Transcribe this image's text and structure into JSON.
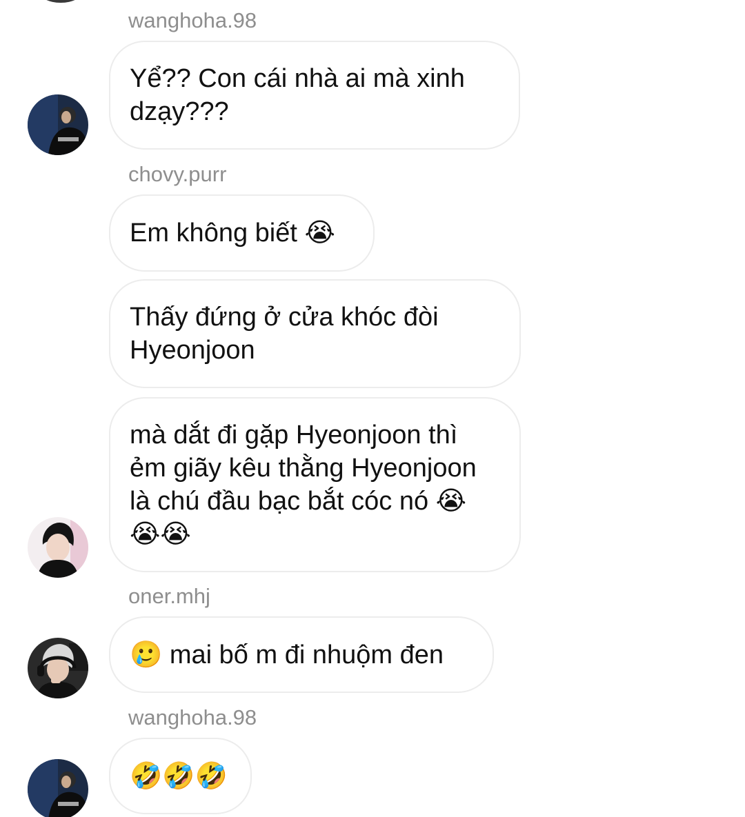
{
  "messages": [
    {
      "username": "wanghoha.98",
      "bubbles": [
        {
          "text": "Yể?? Con cái nhà ai mà xinh\ndzạy???"
        }
      ],
      "avatar_icon": "dark-profile-avatar-icon"
    },
    {
      "username": "chovy.purr",
      "bubbles": [
        {
          "text": "Em không biết 😭"
        },
        {
          "text": "Thấy đứng ở cửa khóc đòi\nHyeonjoon"
        },
        {
          "text": "mà dắt đi gặp Hyeonjoon thì\nẻm giãy kêu thằng Hyeonjoon\nlà chú đầu bạc bắt cóc nó 😭\n😭😭"
        }
      ],
      "avatar_icon": "light-profile-avatar-icon"
    },
    {
      "username": "oner.mhj",
      "bubbles": [
        {
          "text": "🥲 mai bố m đi nhuộm đen"
        }
      ],
      "avatar_icon": "headset-profile-avatar-icon"
    },
    {
      "username": "wanghoha.98",
      "bubbles": [
        {
          "text": "🤣🤣🤣"
        }
      ],
      "avatar_icon": "dark-profile-avatar-icon"
    }
  ],
  "colors": {
    "username": "#8e8e8e",
    "bubble_border": "#ececec",
    "text": "#111111",
    "background": "#ffffff"
  }
}
